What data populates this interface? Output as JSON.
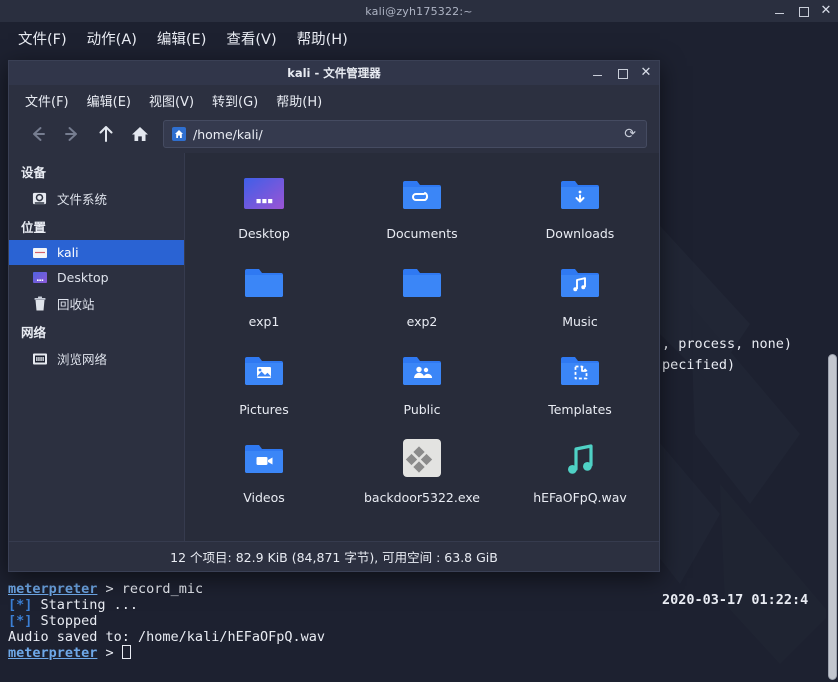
{
  "terminal": {
    "title": "kali@zyh175322:~",
    "menu": [
      {
        "label": "文件(F)",
        "name": "menu-file"
      },
      {
        "label": "动作(A)",
        "name": "menu-actions"
      },
      {
        "label": "编辑(E)",
        "name": "menu-edit"
      },
      {
        "label": "查看(V)",
        "name": "menu-view"
      },
      {
        "label": "帮助(H)",
        "name": "menu-help"
      }
    ],
    "window_controls": {
      "minimize": "_",
      "maximize": "□",
      "close": "✕"
    },
    "occluded_lines": [
      ", process, none)",
      "pecified)"
    ],
    "timestamp": "2020-03-17 01:22:4",
    "output": {
      "prompt1": "meterpreter",
      "arrow": ">",
      "command": "record_mic",
      "line_starting": "Starting ...",
      "line_stopped": "Stopped",
      "line_saved": "Audio saved to: /home/kali/hEFaOFpQ.wav",
      "prompt2": "meterpreter",
      "star": "[*]"
    }
  },
  "filemanager": {
    "title": "kali - 文件管理器",
    "menu": [
      {
        "label": "文件(F)",
        "name": "fm-menu-file"
      },
      {
        "label": "编辑(E)",
        "name": "fm-menu-edit"
      },
      {
        "label": "视图(V)",
        "name": "fm-menu-view"
      },
      {
        "label": "转到(G)",
        "name": "fm-menu-go"
      },
      {
        "label": "帮助(H)",
        "name": "fm-menu-help"
      }
    ],
    "toolbar": {
      "back": "back-icon",
      "forward": "forward-icon",
      "up": "up-icon",
      "home": "home-icon",
      "path": "/home/kali/",
      "reload": "⟳"
    },
    "sidebar": {
      "group_devices": "设备",
      "group_places": "位置",
      "group_network": "网络",
      "devices": [
        {
          "label": "文件系统",
          "icon": "disk-icon"
        }
      ],
      "places": [
        {
          "label": "kali",
          "icon": "home-folder-icon",
          "selected": true
        },
        {
          "label": "Desktop",
          "icon": "desktop-icon",
          "selected": false
        },
        {
          "label": "回收站",
          "icon": "trash-icon",
          "selected": false
        }
      ],
      "network": [
        {
          "label": "浏览网络",
          "icon": "network-icon"
        }
      ]
    },
    "files": [
      {
        "name": "Desktop",
        "icon": "desktop-gradient-icon"
      },
      {
        "name": "Documents",
        "icon": "folder-documents-icon"
      },
      {
        "name": "Downloads",
        "icon": "folder-downloads-icon"
      },
      {
        "name": "exp1",
        "icon": "folder-icon"
      },
      {
        "name": "exp2",
        "icon": "folder-icon"
      },
      {
        "name": "Music",
        "icon": "folder-music-icon"
      },
      {
        "name": "Pictures",
        "icon": "folder-pictures-icon"
      },
      {
        "name": "Public",
        "icon": "folder-public-icon"
      },
      {
        "name": "Templates",
        "icon": "folder-templates-icon"
      },
      {
        "name": "Videos",
        "icon": "folder-videos-icon"
      },
      {
        "name": "backdoor5322.exe",
        "icon": "wine-exe-icon"
      },
      {
        "name": "hEFaOFpQ.wav",
        "icon": "audio-wav-icon"
      }
    ],
    "statusbar": "12 个项目: 82.9 KiB (84,871 字节), 可用空间 : 63.8 GiB"
  },
  "colors": {
    "accent": "#2a63d3",
    "folder": "#2f79f2",
    "audio": "#4fd1c5",
    "terminal_bg": "#1d2130",
    "window_bg": "#2c3040"
  }
}
